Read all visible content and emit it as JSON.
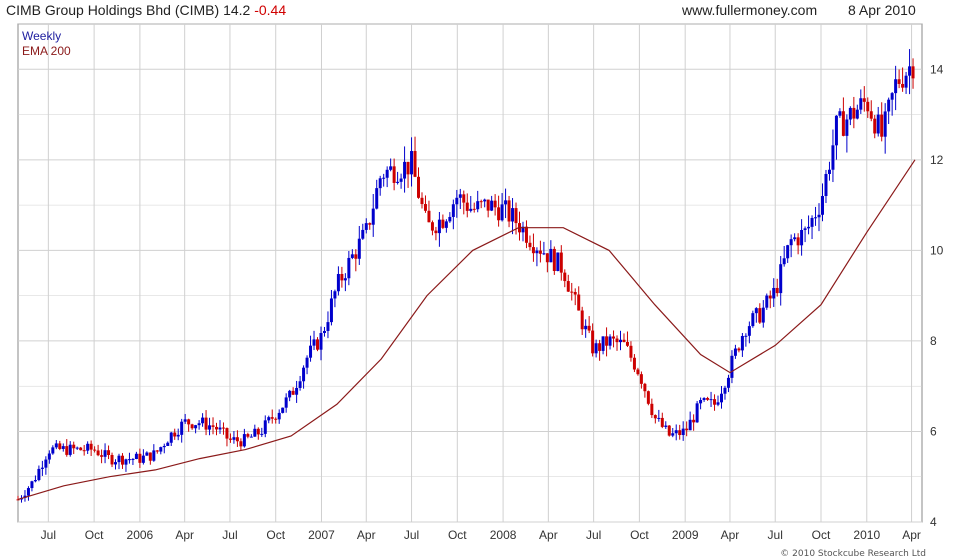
{
  "header": {
    "title": "CIMB Group Holdings Bhd (CIMB)",
    "last": "14.2",
    "change": "-0.44",
    "source": "www.fullermoney.com",
    "date": "8 Apr 2010"
  },
  "footer": {
    "copyright": "© 2010 Stockcube Research Ltd"
  },
  "colors": {
    "up": "#0000cc",
    "down": "#cc0000",
    "ema": "#8b1a1a",
    "grid": "#d0d0d0"
  },
  "chart_data": {
    "type": "candlestick",
    "legend": [
      "Weekly",
      "EMA 200"
    ],
    "legend_placement": "top-left",
    "y_axis": {
      "position": "right",
      "ylim": [
        4,
        15
      ],
      "ticks": [
        4,
        6,
        8,
        10,
        12,
        14
      ]
    },
    "x_axis": {
      "tick_labels": [
        "Jul",
        "Oct",
        "2006",
        "Apr",
        "Jul",
        "Oct",
        "2007",
        "Apr",
        "Jul",
        "Oct",
        "2008",
        "Apr",
        "Jul",
        "Oct",
        "2009",
        "Apr",
        "Jul",
        "Oct",
        "2010",
        "Apr"
      ],
      "range": [
        "2005-05",
        "2010-04-08"
      ]
    },
    "grid": true,
    "series": [
      {
        "name": "Weekly",
        "kind": "candlestick",
        "points": [
          {
            "x": "2005-05-01",
            "close": 4.5
          },
          {
            "x": "2005-06-01",
            "close": 4.9
          },
          {
            "x": "2005-07-01",
            "close": 5.6
          },
          {
            "x": "2005-08-01",
            "close": 5.6
          },
          {
            "x": "2005-09-01",
            "close": 5.6
          },
          {
            "x": "2005-10-01",
            "close": 5.6
          },
          {
            "x": "2005-11-01",
            "close": 5.4
          },
          {
            "x": "2005-12-01",
            "close": 5.4
          },
          {
            "x": "2006-01-01",
            "close": 5.4
          },
          {
            "x": "2006-02-01",
            "close": 5.5
          },
          {
            "x": "2006-03-01",
            "close": 5.9
          },
          {
            "x": "2006-04-01",
            "close": 6.2
          },
          {
            "x": "2006-05-01",
            "close": 6.2
          },
          {
            "x": "2006-06-01",
            "close": 6.1
          },
          {
            "x": "2006-07-01",
            "close": 5.8
          },
          {
            "x": "2006-08-01",
            "close": 5.8
          },
          {
            "x": "2006-09-01",
            "close": 6.0
          },
          {
            "x": "2006-10-01",
            "close": 6.4
          },
          {
            "x": "2006-11-01",
            "close": 6.8
          },
          {
            "x": "2006-12-01",
            "close": 7.6
          },
          {
            "x": "2007-01-01",
            "close": 8.1
          },
          {
            "x": "2007-02-01",
            "close": 9.2
          },
          {
            "x": "2007-03-01",
            "close": 9.8
          },
          {
            "x": "2007-04-01",
            "close": 10.4
          },
          {
            "x": "2007-05-01",
            "close": 11.7
          },
          {
            "x": "2007-06-01",
            "close": 11.8
          },
          {
            "x": "2007-07-01",
            "close": 11.9
          },
          {
            "x": "2007-08-01",
            "close": 10.5
          },
          {
            "x": "2007-09-01",
            "close": 10.7
          },
          {
            "x": "2007-10-01",
            "close": 11.2
          },
          {
            "x": "2007-11-01",
            "close": 10.9
          },
          {
            "x": "2007-12-01",
            "close": 11.0
          },
          {
            "x": "2008-01-01",
            "close": 10.9
          },
          {
            "x": "2008-02-01",
            "close": 10.6
          },
          {
            "x": "2008-03-01",
            "close": 10.2
          },
          {
            "x": "2008-04-01",
            "close": 9.9
          },
          {
            "x": "2008-05-01",
            "close": 9.6
          },
          {
            "x": "2008-06-01",
            "close": 8.6
          },
          {
            "x": "2008-07-01",
            "close": 7.8
          },
          {
            "x": "2008-08-01",
            "close": 8.0
          },
          {
            "x": "2008-09-01",
            "close": 7.9
          },
          {
            "x": "2008-10-01",
            "close": 7.3
          },
          {
            "x": "2008-11-01",
            "close": 6.3
          },
          {
            "x": "2008-12-01",
            "close": 5.9
          },
          {
            "x": "2009-01-01",
            "close": 6.0
          },
          {
            "x": "2009-02-01",
            "close": 6.6
          },
          {
            "x": "2009-03-01",
            "close": 6.6
          },
          {
            "x": "2009-04-01",
            "close": 7.4
          },
          {
            "x": "2009-05-01",
            "close": 8.3
          },
          {
            "x": "2009-06-01",
            "close": 8.6
          },
          {
            "x": "2009-07-01",
            "close": 9.1
          },
          {
            "x": "2009-08-01",
            "close": 10.2
          },
          {
            "x": "2009-09-01",
            "close": 10.4
          },
          {
            "x": "2009-10-01",
            "close": 11.1
          },
          {
            "x": "2009-11-01",
            "close": 12.7
          },
          {
            "x": "2009-12-01",
            "close": 13.0
          },
          {
            "x": "2010-01-01",
            "close": 13.3
          },
          {
            "x": "2010-02-01",
            "close": 12.5
          },
          {
            "x": "2010-03-01",
            "close": 13.7
          },
          {
            "x": "2010-04-08",
            "close": 14.2
          }
        ]
      },
      {
        "name": "EMA 200",
        "kind": "line",
        "points": [
          {
            "x": "2005-05-01",
            "y": 4.5
          },
          {
            "x": "2005-08-01",
            "y": 4.8
          },
          {
            "x": "2005-11-01",
            "y": 5.0
          },
          {
            "x": "2006-02-01",
            "y": 5.15
          },
          {
            "x": "2006-05-01",
            "y": 5.4
          },
          {
            "x": "2006-08-01",
            "y": 5.6
          },
          {
            "x": "2006-11-01",
            "y": 5.9
          },
          {
            "x": "2007-02-01",
            "y": 6.6
          },
          {
            "x": "2007-05-01",
            "y": 7.6
          },
          {
            "x": "2007-08-01",
            "y": 9.0
          },
          {
            "x": "2007-11-01",
            "y": 10.0
          },
          {
            "x": "2008-02-01",
            "y": 10.5
          },
          {
            "x": "2008-05-01",
            "y": 10.5
          },
          {
            "x": "2008-08-01",
            "y": 10.0
          },
          {
            "x": "2008-11-01",
            "y": 8.8
          },
          {
            "x": "2009-02-01",
            "y": 7.7
          },
          {
            "x": "2009-04-01",
            "y": 7.3
          },
          {
            "x": "2009-07-01",
            "y": 7.9
          },
          {
            "x": "2009-10-01",
            "y": 8.8
          },
          {
            "x": "2010-01-01",
            "y": 10.4
          },
          {
            "x": "2010-04-08",
            "y": 12.0
          }
        ]
      }
    ]
  }
}
